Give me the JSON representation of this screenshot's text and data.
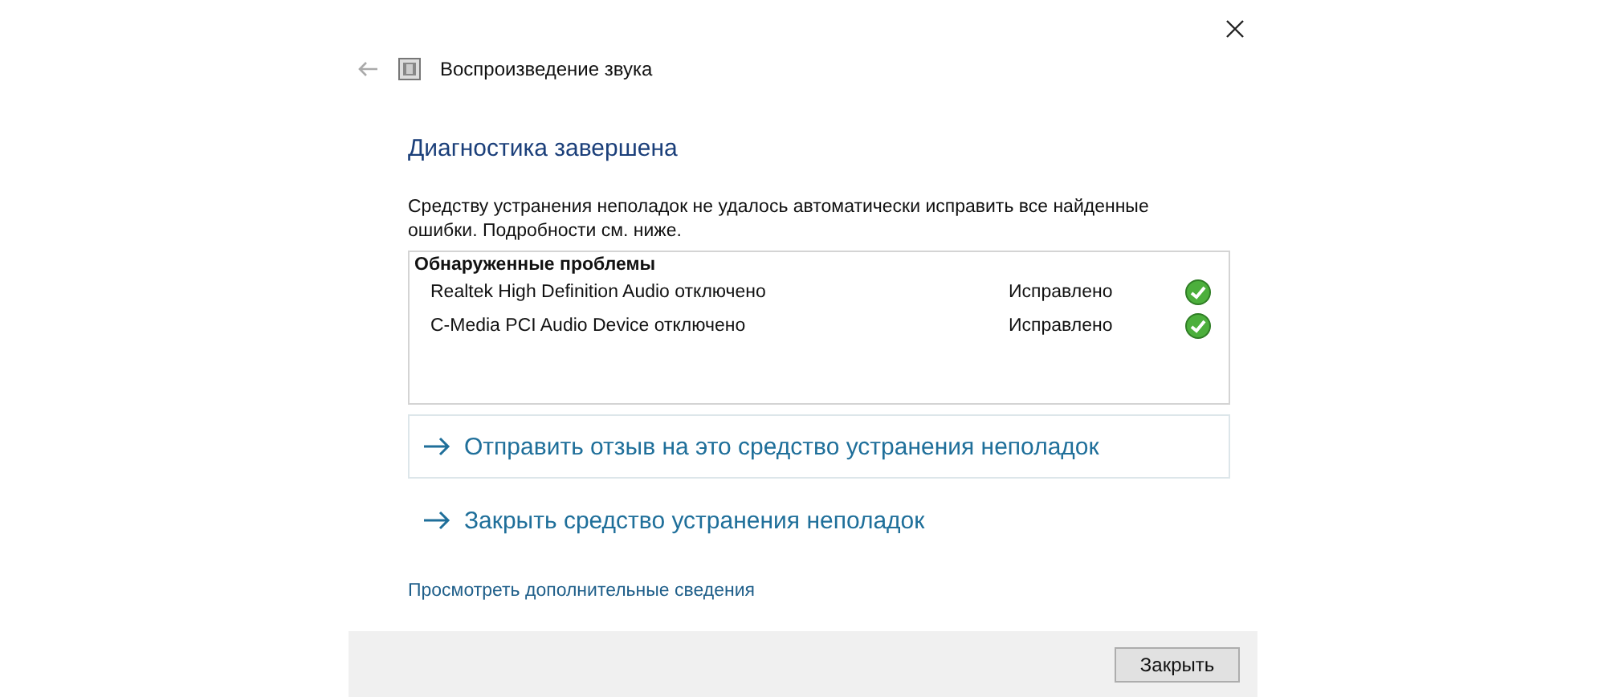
{
  "window": {
    "title": "Воспроизведение звука"
  },
  "heading": "Диагностика завершена",
  "description": "Средству устранения неполадок не удалось автоматически исправить все найденные ошибки. Подробности см. ниже.",
  "problems": {
    "title": "Обнаруженные проблемы",
    "rows": [
      {
        "name": "Realtek High Definition Audio отключено",
        "status": "Исправлено"
      },
      {
        "name": "C-Media PCI Audio Device отключено",
        "status": "Исправлено"
      }
    ]
  },
  "actions": [
    {
      "label": "Отправить отзыв на это средство устранения неполадок",
      "selected": true
    },
    {
      "label": "Закрыть средство устранения неполадок",
      "selected": false
    }
  ],
  "more_link": "Просмотреть дополнительные сведения",
  "buttons": [
    "Закрыть"
  ]
}
